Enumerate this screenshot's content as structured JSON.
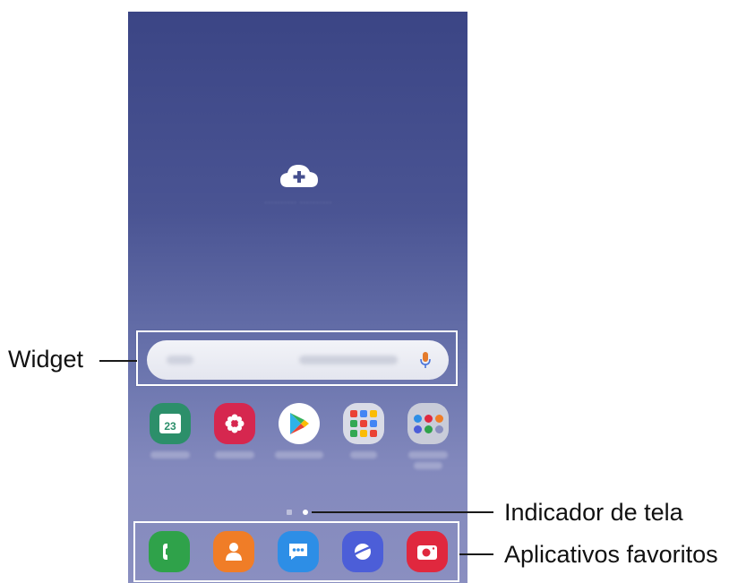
{
  "callouts": {
    "widget": "Widget",
    "screen_indicator": "Indicador de tela",
    "favorite_apps": "Aplicativos favoritos"
  },
  "home_screen": {
    "add_widget_icon": "cloud-plus-icon",
    "calendar_day": "23",
    "page_indicator": {
      "pages": 2,
      "current": 2
    },
    "colors": {
      "wallpaper_top": "#3b4585",
      "wallpaper_bottom": "#8a8fc0",
      "calendar": "#2c8f6a",
      "gallery": "#d6274f",
      "phone": "#2fa24a",
      "contacts": "#f07d27",
      "messages": "#2d8ee6",
      "internet": "#4c5ed8",
      "camera": "#e0283e"
    },
    "apps": [
      "calendar-icon",
      "gallery-icon",
      "play-store-icon",
      "google-folder-icon",
      "apps-folder-icon"
    ],
    "dock": [
      "phone-icon",
      "contacts-icon",
      "messages-icon",
      "internet-icon",
      "camera-icon"
    ]
  }
}
